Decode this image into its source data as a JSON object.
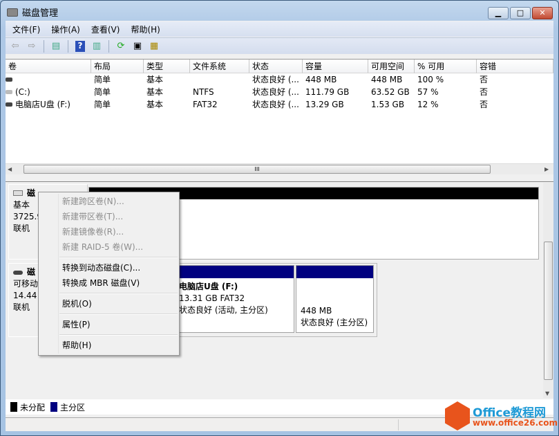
{
  "window": {
    "title": "磁盘管理",
    "min": "▁",
    "max": "□",
    "close": "✕"
  },
  "menubar": [
    "文件(F)",
    "操作(A)",
    "查看(V)",
    "帮助(H)"
  ],
  "toolbar": {
    "icons": [
      "back-icon",
      "forward-icon",
      "console-tree-icon",
      "help-icon",
      "action-pane-icon",
      "refresh-icon",
      "properties-icon",
      "disk-settings-icon"
    ]
  },
  "columns": [
    "卷",
    "布局",
    "类型",
    "文件系统",
    "状态",
    "容量",
    "可用空间",
    "% 可用",
    "容错"
  ],
  "rows": [
    [
      "",
      "简单",
      "基本",
      "",
      "状态良好 (...",
      "448 MB",
      "448 MB",
      "100 %",
      "否"
    ],
    [
      "(C:)",
      "简单",
      "基本",
      "NTFS",
      "状态良好 (...",
      "111.79 GB",
      "63.52 GB",
      "57 %",
      "否"
    ],
    [
      "电脑店U盘 (F:)",
      "简单",
      "基本",
      "FAT32",
      "状态良好 (...",
      "13.29 GB",
      "1.53 GB",
      "12 %",
      "否"
    ]
  ],
  "hscroll_grip": "III",
  "disks": [
    {
      "name": "磁",
      "type": "基本",
      "size": "3725.9",
      "status": "联机"
    },
    {
      "name": "磁",
      "type": "可移动",
      "size": "14.44",
      "status": "联机",
      "partitions": [
        {
          "name": "电脑店U盘  (F:)",
          "size": "13.31 GB FAT32",
          "status": "状态良好 (活动, 主分区)"
        },
        {
          "name": "",
          "size": "448 MB",
          "status": "状态良好 (主分区)"
        }
      ]
    }
  ],
  "context_menu": {
    "items": [
      {
        "label": "新建跨区卷(N)...",
        "enabled": false
      },
      {
        "label": "新建带区卷(T)...",
        "enabled": false
      },
      {
        "label": "新建镜像卷(R)...",
        "enabled": false
      },
      {
        "label": "新建 RAID-5 卷(W)...",
        "enabled": false
      },
      {
        "label": "转换到动态磁盘(C)...",
        "enabled": true
      },
      {
        "label": "转换成 MBR 磁盘(V)",
        "enabled": true
      },
      {
        "label": "脱机(O)",
        "enabled": true
      },
      {
        "label": "属性(P)",
        "enabled": true
      },
      {
        "label": "帮助(H)",
        "enabled": true
      }
    ]
  },
  "legend": [
    {
      "label": "未分配",
      "color": "#000000"
    },
    {
      "label": "主分区",
      "color": "#000080"
    }
  ],
  "watermark": {
    "brand": "Office教程网",
    "url": "www.office26.com"
  }
}
